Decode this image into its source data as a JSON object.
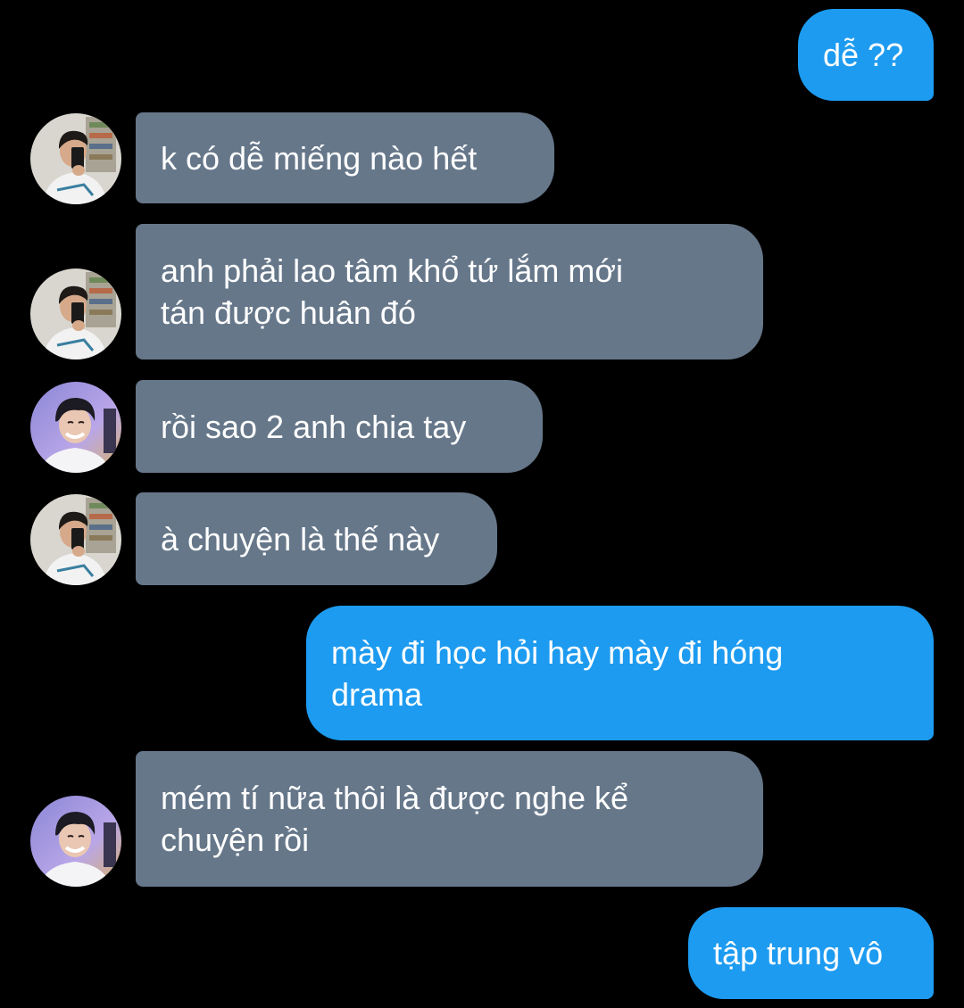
{
  "conversation": {
    "messages": [
      {
        "direction": "outgoing",
        "text": "dễ ??"
      },
      {
        "direction": "incoming",
        "sender_avatar": "avatar-selfie",
        "text": "k có dễ miếng nào hết"
      },
      {
        "direction": "incoming",
        "sender_avatar": "avatar-selfie",
        "text": "anh phải lao tâm khổ tứ lắm mới\ntán được huân đó"
      },
      {
        "direction": "incoming",
        "sender_avatar": "avatar-smiling",
        "text": "rồi sao 2 anh chia tay"
      },
      {
        "direction": "incoming",
        "sender_avatar": "avatar-selfie",
        "text": "à chuyện là thế này"
      },
      {
        "direction": "outgoing",
        "text": "mày đi học hỏi hay mày đi hóng\ndrama"
      },
      {
        "direction": "incoming",
        "sender_avatar": "avatar-smiling",
        "text": "mém tí nữa thôi là được nghe kể\nchuyện rồi"
      },
      {
        "direction": "outgoing",
        "text": "tập trung vô"
      }
    ]
  },
  "colors": {
    "background": "#000000",
    "incoming_bubble": "#66778a",
    "outgoing_bubble": "#1d9bf0",
    "text": "#ffffff"
  }
}
